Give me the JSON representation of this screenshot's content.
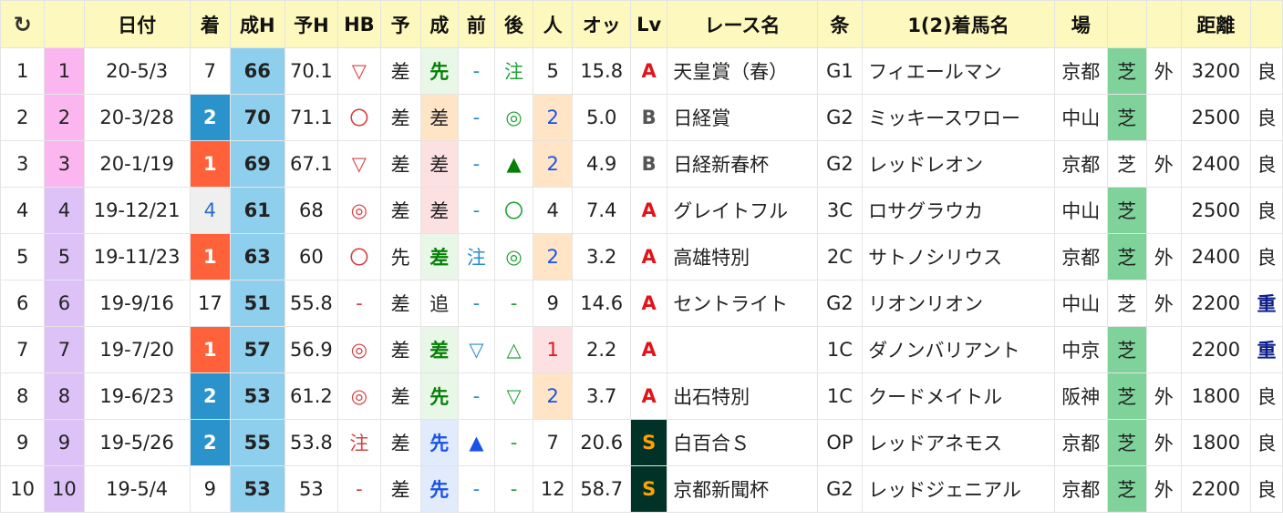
{
  "header": {
    "refresh_icon": "↻",
    "columns": [
      "日付",
      "着",
      "成H",
      "予H",
      "HB",
      "予",
      "成",
      "前",
      "後",
      "人",
      "オッ",
      "Lv",
      "レース名",
      "条",
      "1(2)着馬名",
      "場",
      "",
      "",
      "距離",
      ""
    ]
  },
  "rows": [
    {
      "n": "1",
      "num": "1",
      "date": "20-5/3",
      "finish": "7",
      "sei_h": "66",
      "yo_h": "70.1",
      "hb": "▽",
      "yoso": "差",
      "sei": "先",
      "mae": "-",
      "ato": "注",
      "ninki": "5",
      "odds": "15.8",
      "lv": "A",
      "race": "天皇賞（春）",
      "cls": "G1",
      "horse": "フィエールマン",
      "place": "京都",
      "surface": "芝",
      "inout": "外",
      "dist": "3200",
      "cond": "良"
    },
    {
      "n": "2",
      "num": "2",
      "date": "20-3/28",
      "finish": "2",
      "sei_h": "70",
      "yo_h": "71.1",
      "hb": "〇",
      "yoso": "差",
      "sei": "差",
      "mae": "-",
      "ato": "◎",
      "ninki": "2",
      "odds": "5.0",
      "lv": "B",
      "race": "日経賞",
      "cls": "G2",
      "horse": "ミッキースワロー",
      "place": "中山",
      "surface": "芝",
      "inout": "",
      "dist": "2500",
      "cond": "良"
    },
    {
      "n": "3",
      "num": "3",
      "date": "20-1/19",
      "finish": "1",
      "sei_h": "69",
      "yo_h": "67.1",
      "hb": "▽",
      "yoso": "差",
      "sei": "差",
      "mae": "-",
      "ato": "▲",
      "ninki": "2",
      "odds": "4.9",
      "lv": "B",
      "race": "日経新春杯",
      "cls": "G2",
      "horse": "レッドレオン",
      "place": "京都",
      "surface": "芝",
      "inout": "外",
      "dist": "2400",
      "cond": "良"
    },
    {
      "n": "4",
      "num": "4",
      "date": "19-12/21",
      "finish": "4",
      "sei_h": "61",
      "yo_h": "68",
      "hb": "◎",
      "yoso": "差",
      "sei": "差",
      "mae": "-",
      "ato": "〇",
      "ninki": "4",
      "odds": "7.4",
      "lv": "A",
      "race": "グレイトフル",
      "cls": "3C",
      "horse": "ロサグラウカ",
      "place": "中山",
      "surface": "芝",
      "inout": "",
      "dist": "2500",
      "cond": "良"
    },
    {
      "n": "5",
      "num": "5",
      "date": "19-11/23",
      "finish": "1",
      "sei_h": "63",
      "yo_h": "60",
      "hb": "〇",
      "yoso": "先",
      "sei": "差",
      "mae": "注",
      "ato": "◎",
      "ninki": "2",
      "odds": "3.2",
      "lv": "A",
      "race": "高雄特別",
      "cls": "2C",
      "horse": "サトノシリウス",
      "place": "京都",
      "surface": "芝",
      "inout": "外",
      "dist": "2400",
      "cond": "良"
    },
    {
      "n": "6",
      "num": "6",
      "date": "19-9/16",
      "finish": "17",
      "sei_h": "51",
      "yo_h": "55.8",
      "hb": "-",
      "yoso": "差",
      "sei": "追",
      "mae": "-",
      "ato": "-",
      "ninki": "9",
      "odds": "14.6",
      "lv": "A",
      "race": "セントライト",
      "cls": "G2",
      "horse": "リオンリオン",
      "place": "中山",
      "surface": "芝",
      "inout": "外",
      "dist": "2200",
      "cond": "重"
    },
    {
      "n": "7",
      "num": "7",
      "date": "19-7/20",
      "finish": "1",
      "sei_h": "57",
      "yo_h": "56.9",
      "hb": "◎",
      "yoso": "差",
      "sei": "差",
      "mae": "▽",
      "ato": "△",
      "ninki": "1",
      "odds": "2.2",
      "lv": "A",
      "race": "",
      "cls": "1C",
      "horse": "ダノンバリアント",
      "place": "中京",
      "surface": "芝",
      "inout": "",
      "dist": "2200",
      "cond": "重"
    },
    {
      "n": "8",
      "num": "8",
      "date": "19-6/23",
      "finish": "2",
      "sei_h": "53",
      "yo_h": "61.2",
      "hb": "◎",
      "yoso": "差",
      "sei": "先",
      "mae": "-",
      "ato": "▽",
      "ninki": "2",
      "odds": "3.7",
      "lv": "A",
      "race": "出石特別",
      "cls": "1C",
      "horse": "クードメイトル",
      "place": "阪神",
      "surface": "芝",
      "inout": "外",
      "dist": "1800",
      "cond": "良"
    },
    {
      "n": "9",
      "num": "9",
      "date": "19-5/26",
      "finish": "2",
      "sei_h": "55",
      "yo_h": "53.8",
      "hb": "注",
      "yoso": "差",
      "sei": "先",
      "mae": "▲",
      "ato": "-",
      "ninki": "7",
      "odds": "20.6",
      "lv": "S",
      "race": "白百合Ｓ",
      "cls": "OP",
      "horse": "レッドアネモス",
      "place": "京都",
      "surface": "芝",
      "inout": "外",
      "dist": "1800",
      "cond": "良"
    },
    {
      "n": "10",
      "num": "10",
      "date": "19-5/4",
      "finish": "9",
      "sei_h": "53",
      "yo_h": "53",
      "hb": "-",
      "yoso": "差",
      "sei": "先",
      "mae": "-",
      "ato": "-",
      "ninki": "12",
      "odds": "58.7",
      "lv": "S",
      "race": "京都新聞杯",
      "cls": "G2",
      "horse": "レッドジェニアル",
      "place": "京都",
      "surface": "芝",
      "inout": "外",
      "dist": "2200",
      "cond": "良"
    }
  ],
  "colors": {
    "header_bg": "#fdf8bd",
    "first_place": "#ff613a",
    "second_place": "#2a93cc",
    "turf": "#7fd39a",
    "rating_col": "#8fcfee",
    "lv_s_bg": "#013228"
  }
}
